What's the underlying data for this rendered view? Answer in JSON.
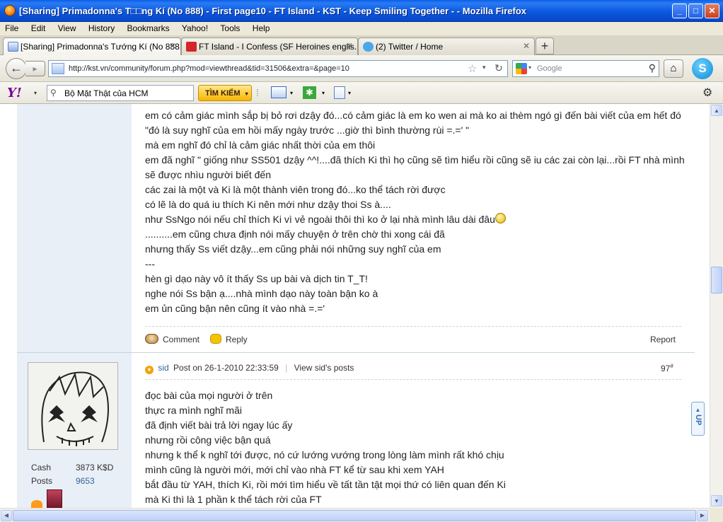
{
  "window": {
    "title": "[Sharing] Primadonna's T□□ng Kí (No 888) - First page10 - FT Island - KST - Keep Smiling Together - - Mozilla Firefox",
    "minimize": "_",
    "maximize": "□",
    "close": "✕"
  },
  "menu": [
    "File",
    "Edit",
    "View",
    "History",
    "Bookmarks",
    "Yahoo!",
    "Tools",
    "Help"
  ],
  "tabs": [
    {
      "label": "[Sharing] Primadonna's Tướng Kí (No 888...",
      "close": "✕"
    },
    {
      "label": "FT Island - I Confess (SF Heroines englis...",
      "close": "✕"
    },
    {
      "label": "(2) Twitter / Home",
      "close": "✕"
    }
  ],
  "newtab": "+",
  "nav": {
    "back": "←",
    "forward": "▸",
    "url": "http://kst.vn/community/forum.php?mod=viewthread&tid=31506&extra=&page=10",
    "star": "☆",
    "dropdown": "▾",
    "reload": "↻",
    "search_placeholder": "Google",
    "search_drop": "▾",
    "search_icon": "⚲",
    "home": "⌂",
    "skype": "S"
  },
  "yahoo": {
    "logo": "Y!",
    "logo_drop": "▾",
    "search_icon": "⚲",
    "search_value": "Bộ Mặt Thật của HCM",
    "search_button": "TÌM KIẾM",
    "search_button_drop": "▾",
    "gear": "⚙"
  },
  "post1": {
    "lines": [
      "em có cảm giác mình sắp bị bỏ rơi dzậy đó...có cảm giác là em ko wen ai mà ko ai thèm ngó gì đến bài viết của em hết đó",
      "\"đó là suy nghĩ của em hồi mấy ngày trước ...giờ thì bình thường rùi =.=' \"",
      "mà em nghĩ đó chỉ là cảm giác nhất thời của em thôi",
      "em đã nghĩ  \" giống như SS501 dzậy ^^!....đã thích Ki thì họ cũng sẽ tìm hiểu rồi cũng sẽ iu các zai còn lại...rồi FT nhà mình",
      "sẽ được nhìu người biết đến",
      "các zai là một và Ki là một thành viên trong đó...ko thể tách rời được",
      "có lẽ là do quá iu thích Ki nên mới như dzậy thoi Ss à....",
      "như SsNgo nói nếu chỉ thích Ki vì vẻ ngoài thôi thì ko ở lại nhà mình lâu dài đâu",
      "..........em cũng chưa định nói mấy chuyện ở trên chờ thi xong cái đã",
      "nhưng thấy Ss viết dzậy...em cũng phải nói những suy nghĩ của em",
      "---",
      "hèn gì dạo này vô ít thấy Ss up bài và dịch tin T_T!",
      "nghe nói Ss bận ạ....nhà mình dạo này toàn bận ko à",
      "em ủn cũng bận nên cũng ít vào nhà =.='"
    ],
    "comment": "Comment",
    "reply": "Reply",
    "report": "Report"
  },
  "post2": {
    "author": "sid",
    "posted": "Post on 26-1-2010 22:33:59",
    "view_posts": "View sid's posts",
    "sep": "|",
    "number": "97",
    "number_sup": "#",
    "stats": {
      "cash_label": "Cash",
      "cash_value": "3873 K$D",
      "posts_label": "Posts",
      "posts_value": "9653"
    },
    "lines": [
      "đọc bài của mọi người ở trên",
      "thực ra mình nghĩ mãi",
      "đã định viết bài trả lời ngay lúc ấy",
      "nhưng rồi công việc bận quá",
      "nhưng k thể k nghĩ tới được, nó cứ lướng vướng trong lòng làm mình rất khó chịu",
      "mình cũng là người mới, mới chỉ vào nhà FT kể từ sau khi xem YAH",
      "bắt đầu từ YAH, thích Ki, rồi mới tìm hiểu về tất tần tật mọi thứ có liên quan đến Ki",
      "mà Ki thì là 1 phần k thể tách rời của FT"
    ]
  },
  "up_button": "UP",
  "scroll": {
    "up": "▲",
    "down": "▼",
    "left": "◀",
    "right": "▶"
  },
  "colors": {
    "titlebar": "#0a5ee8",
    "link": "#336699",
    "sidebar": "#e8eff7",
    "yahoo_button": "#f7b600"
  }
}
